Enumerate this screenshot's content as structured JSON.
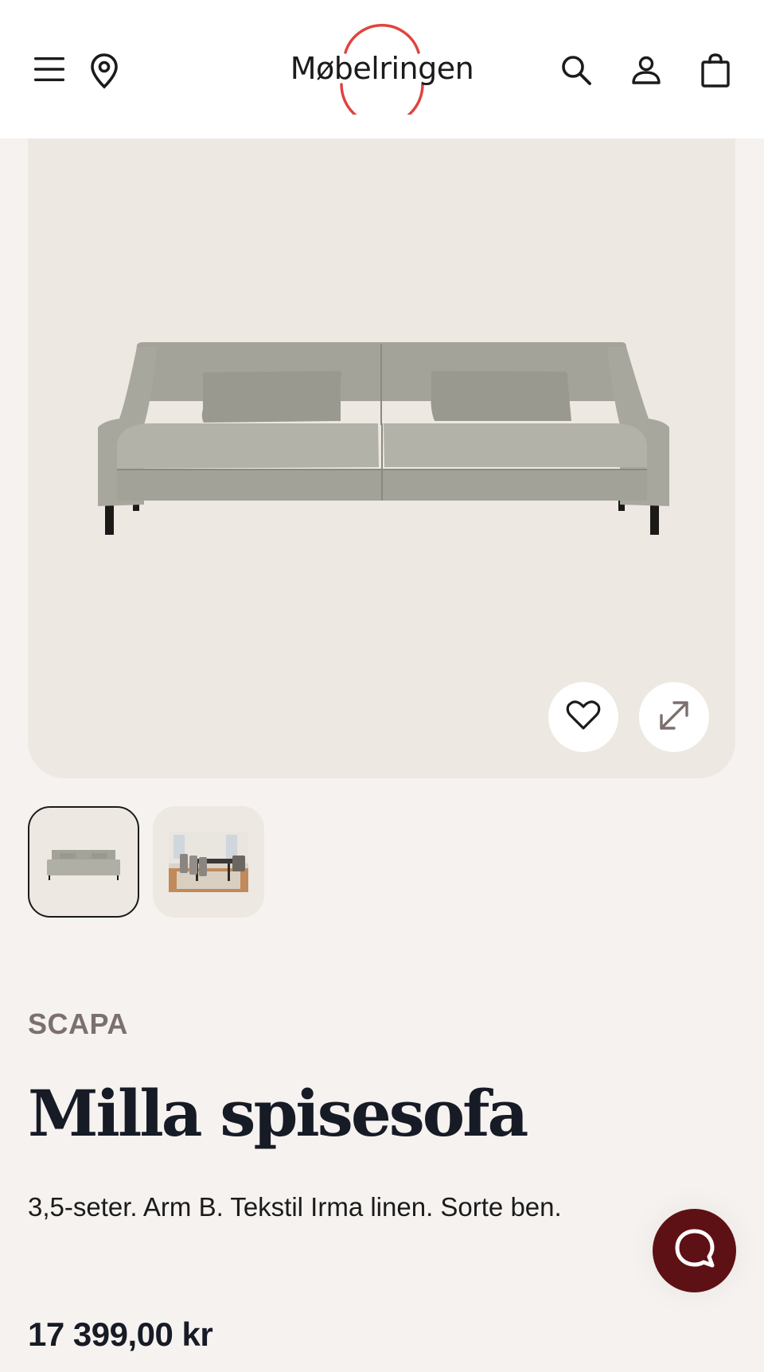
{
  "header": {
    "logo_text": "Møbelringen",
    "icons": [
      "menu-icon",
      "location-pin-icon",
      "search-icon",
      "user-icon",
      "shopping-bag-icon"
    ],
    "accent": "#e0443e"
  },
  "gallery": {
    "thumbnails": [
      "thumbnail-sofa",
      "thumbnail-dining-room"
    ],
    "active_index": 0,
    "actions": [
      "heart-icon",
      "expand-icon"
    ]
  },
  "product": {
    "brand": "SCAPA",
    "name": "Milla spisesofa",
    "description": "3,5-seter. Arm B. Tekstil Irma linen. Sorte ben.",
    "price": "17 399,00 kr"
  },
  "chat": {
    "icon": "chat-icon",
    "color": "#5e1114"
  }
}
